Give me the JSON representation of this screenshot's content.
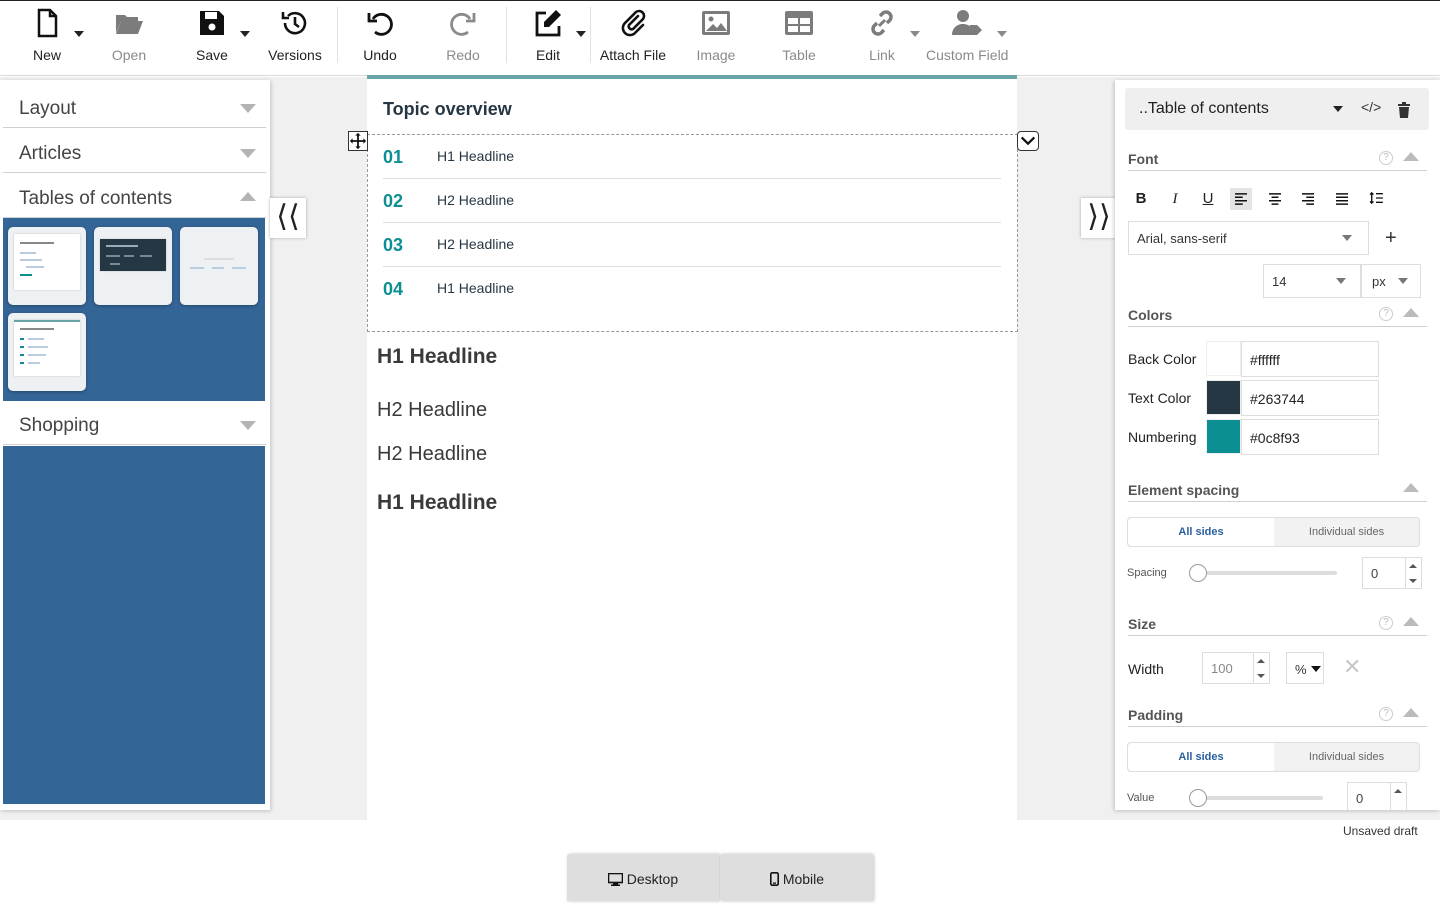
{
  "toolbar": {
    "new": "New",
    "open": "Open",
    "save": "Save",
    "versions": "Versions",
    "undo": "Undo",
    "redo": "Redo",
    "edit": "Edit",
    "attach": "Attach File",
    "image": "Image",
    "table": "Table",
    "link": "Link",
    "custom_field": "Custom Field"
  },
  "left_panel": {
    "sections": [
      "Layout",
      "Articles",
      "Tables of contents",
      "Shopping"
    ]
  },
  "canvas": {
    "toc_title": "Topic overview",
    "toc_items": [
      {
        "num": "01",
        "text": "H1 Headline"
      },
      {
        "num": "02",
        "text": "H2 Headline"
      },
      {
        "num": "03",
        "text": "H2 Headline"
      },
      {
        "num": "04",
        "text": "H1 Headline"
      }
    ],
    "headings": [
      {
        "level": "h1",
        "text": "H1 Headline"
      },
      {
        "level": "h2",
        "text": "H2 Headline"
      },
      {
        "level": "h2",
        "text": "H2 Headline"
      },
      {
        "level": "h1",
        "text": "H1 Headline"
      }
    ]
  },
  "right_panel": {
    "element_select": "..Table of contents",
    "font": {
      "title": "Font",
      "family": "Arial, sans-serif",
      "size": "14",
      "unit": "px"
    },
    "colors": {
      "title": "Colors",
      "back_label": "Back Color",
      "back_value": "#ffffff",
      "text_label": "Text Color",
      "text_value": "#263744",
      "numbering_label": "Numbering",
      "numbering_value": "#0c8f93"
    },
    "spacing": {
      "title": "Element spacing",
      "all_sides": "All sides",
      "individual_sides": "Individual sides",
      "label": "Spacing",
      "value": "0"
    },
    "size": {
      "title": "Size",
      "width_label": "Width",
      "width_value": "100",
      "unit": "%"
    },
    "padding": {
      "title": "Padding",
      "all_sides": "All sides",
      "individual_sides": "Individual sides",
      "label": "Value",
      "value": "0"
    }
  },
  "status": "Unsaved draft",
  "views": {
    "desktop": "Desktop",
    "mobile": "Mobile"
  },
  "colors": {
    "accent": "#0c8f93",
    "panel_blue": "#346597",
    "text": "#263744"
  }
}
